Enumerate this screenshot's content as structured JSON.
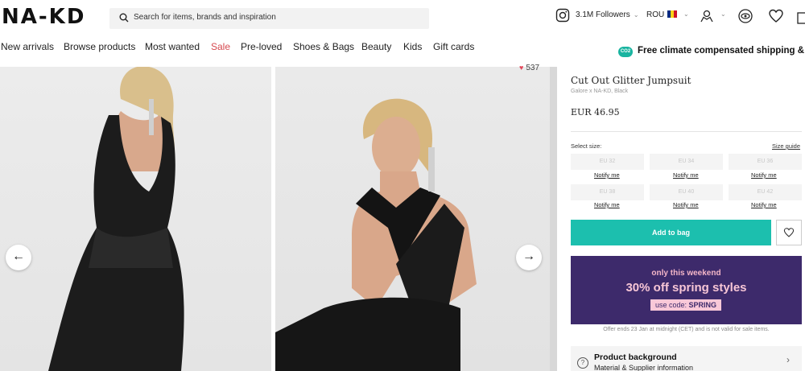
{
  "header": {
    "logo": "NA-KD",
    "search_placeholder": "Search for items, brands and inspiration",
    "followers": "3.1M Followers",
    "country": "ROU",
    "flag_colors": [
      "#002b7f",
      "#fcd116",
      "#ce1126"
    ]
  },
  "nav": {
    "items": [
      "New arrivals",
      "Browse products",
      "Most wanted",
      "Sale",
      "Pre-loved",
      "Shoes & Bags",
      "Beauty",
      "Kids",
      "Gift cards"
    ],
    "co2_badge": "CO2",
    "climate_text": "Free climate compensated shipping & retu"
  },
  "gallery": {
    "likes": "537",
    "prev_arrow": "←",
    "next_arrow": "→"
  },
  "product": {
    "title": "Cut Out Glitter Jumpsuit",
    "subtitle": "Galore x NA-KD, Black",
    "price": "EUR 46.95",
    "select_size_label": "Select size:",
    "size_guide": "Size guide",
    "sizes": [
      "EU 32",
      "EU 34",
      "EU 36",
      "EU 38",
      "EU 40",
      "EU 42"
    ],
    "notify_label": "Notify me",
    "add_to_bag": "Add to bag"
  },
  "promo": {
    "line1": "only this weekend",
    "line2": "30% off spring styles",
    "code_prefix": "use code: ",
    "code": "SPRING",
    "offer_note": "Offer ends 23 Jan at midnight (CET) and is not valid for sale items."
  },
  "product_background": {
    "title": "Product background",
    "subtitle": "Material & Supplier information",
    "icon": "?"
  },
  "colors": {
    "accent_teal": "#1cbfae",
    "promo_purple": "#3d2a6b",
    "sale_red": "#d6494f"
  }
}
